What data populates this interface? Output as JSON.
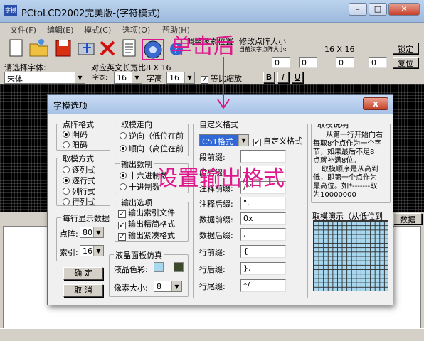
{
  "window": {
    "title": "PCtoLCD2002完美版-(字符模式)",
    "icon": "字模"
  },
  "menu": [
    "文件(F)",
    "编辑(E)",
    "模式(C)",
    "选项(O)",
    "帮助(H)"
  ],
  "toolbar": {
    "font_label": "请选择字体:",
    "font_value": "宋体",
    "width_label": "字宽:",
    "width_value": "16",
    "height_label": "字高",
    "height_value": "16",
    "en_size_label": "对应英文长宽比8 X 16",
    "scale_label": "等比缩放",
    "bold": "B",
    "italic": "I",
    "underline": "U",
    "adjust_label": "调整像素位置",
    "dot_label": "修改点阵大小",
    "dot_sub": "当前汉字点阵大小:",
    "dot_value": "16 X 16",
    "lock_btn": "锁定",
    "reset_btn": "复位",
    "spin0": "0",
    "data_tab": "数据"
  },
  "dialog": {
    "title": "字模选项",
    "close": "x",
    "dot_format": {
      "title": "点阵格式",
      "options": [
        "阴码",
        "阳码"
      ],
      "selected": 0
    },
    "mode": {
      "title": "取模方式",
      "options": [
        "逐列式",
        "逐行式",
        "列行式",
        "行列式"
      ],
      "selected": 1
    },
    "per_line": {
      "title": "每行显示数据",
      "dot_label": "点阵:",
      "dot_value": "80",
      "index_label": "索引:",
      "index_value": "16"
    },
    "ok_btn": "确  定",
    "cancel_btn": "取  消",
    "direction": {
      "title": "取模走向",
      "options": [
        "逆向（低位在前",
        "顺向（高位在前"
      ],
      "selected": 1
    },
    "output_num": {
      "title": "输出数制",
      "options": [
        "十六进制数",
        "十进制数"
      ],
      "selected": 0
    },
    "output_opts": {
      "title": "输出选项",
      "items": [
        "输出索引文件",
        "输出精简格式",
        "输出紧凑格式"
      ]
    },
    "lcd": {
      "title": "液晶面板仿真",
      "color_label": "液晶色彩:",
      "pixel_label": "像素大小:",
      "pixel_value": "8",
      "colors": [
        "#a8d8f0",
        "#3a4a2a"
      ]
    },
    "custom": {
      "title": "自定义格式",
      "format_value": "C51格式",
      "custom_chk": "自定义格式",
      "rows": [
        {
          "label": "段前缀:",
          "value": ""
        },
        {
          "label": "段后缀:",
          "value": ""
        },
        {
          "label": "注释前缀:",
          "value": "/*\""
        },
        {
          "label": "注释后缀:",
          "value": "\","
        },
        {
          "label": "数据前缀:",
          "value": "0x"
        },
        {
          "label": "数据后缀:",
          "value": ","
        },
        {
          "label": "行前缀:",
          "value": "{"
        },
        {
          "label": "行后缀:",
          "value": "},"
        },
        {
          "label": "行尾缀:",
          "value": "*/"
        }
      ]
    },
    "desc": {
      "title": "取模说明",
      "lines": [
        "从第一行开始向右",
        "每取8个点作为一个字",
        "节，如果最后不足8",
        "点就补满8位。",
        "取模顺序是从高到",
        "低，即第一个点作为",
        "最高位。如*-------取",
        "为10000000"
      ]
    },
    "preview_title": "取模演示（从低位到"
  },
  "annotations": {
    "click_here": "单击后",
    "set_format": "设置输出格式"
  },
  "colors": {
    "annotation": "#e0178c",
    "canvas": "#000000",
    "preview": "#a8d8f0"
  }
}
